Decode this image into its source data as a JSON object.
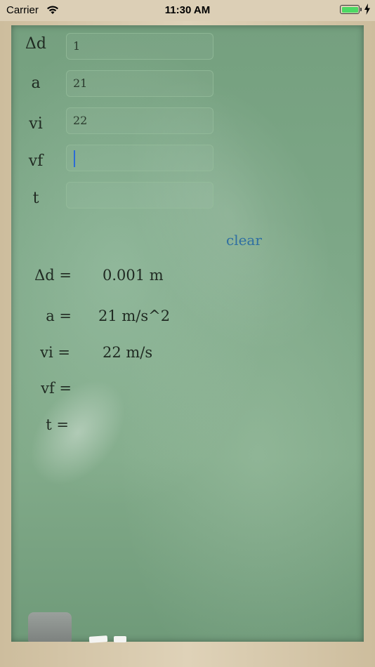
{
  "status_bar": {
    "carrier": "Carrier",
    "time": "11:30 AM"
  },
  "inputs": [
    {
      "label": "Δd",
      "value": "1"
    },
    {
      "label": "a",
      "value": "21"
    },
    {
      "label": "vi",
      "value": "22"
    },
    {
      "label": "vf",
      "value": ""
    },
    {
      "label": "t",
      "value": ""
    }
  ],
  "clear_label": "clear",
  "results": [
    {
      "label": "Δd =",
      "value": "0.001 m"
    },
    {
      "label": "a =",
      "value": "21 m/s^2"
    },
    {
      "label": "vi =",
      "value": "22 m/s"
    },
    {
      "label": "vf =",
      "value": ""
    },
    {
      "label": "t =",
      "value": ""
    }
  ],
  "colors": {
    "board": "#7ea888",
    "frame": "#d8cbb0",
    "clear": "#2f6fa2",
    "caret": "#2c6bd6"
  }
}
